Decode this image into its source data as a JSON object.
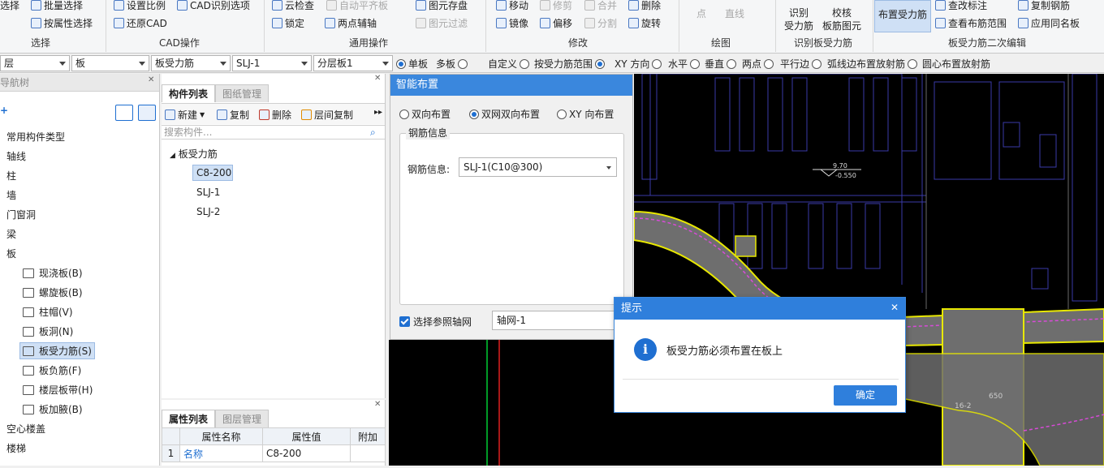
{
  "ribbon": {
    "items": [
      {
        "label": "选择",
        "icon": "select-icon"
      },
      {
        "label": "批量选择",
        "icon": "batch-select-icon"
      },
      {
        "label": "按属性选择",
        "icon": "select-by-property-icon"
      },
      {
        "label": "设置比例",
        "icon": "set-scale-icon"
      },
      {
        "label": "CAD识别选项",
        "icon": "cad-options-icon"
      },
      {
        "label": "还原CAD",
        "icon": "restore-cad-icon"
      },
      {
        "label": "云检查",
        "icon": "cloud-check-icon"
      },
      {
        "label": "自动平齐板",
        "icon": "auto-align-icon"
      },
      {
        "label": "图元存盘",
        "icon": "save-element-icon"
      },
      {
        "label": "锁定",
        "icon": "lock-icon"
      },
      {
        "label": "两点辅轴",
        "icon": "two-point-axis-icon"
      },
      {
        "label": "图元过滤",
        "icon": "filter-icon"
      },
      {
        "label": "移动",
        "icon": "move-icon"
      },
      {
        "label": "修剪",
        "icon": "trim-icon"
      },
      {
        "label": "合并",
        "icon": "merge-icon"
      },
      {
        "label": "删除",
        "icon": "delete-icon"
      },
      {
        "label": "镜像",
        "icon": "mirror-icon"
      },
      {
        "label": "偏移",
        "icon": "offset-icon"
      },
      {
        "label": "分割",
        "icon": "split-icon"
      },
      {
        "label": "旋转",
        "icon": "rotate-icon"
      },
      {
        "label": "点",
        "icon": "point-icon"
      },
      {
        "label": "直线",
        "icon": "line-icon"
      },
      {
        "label": "查改标注",
        "icon": "edit-annotation-icon"
      },
      {
        "label": "复制钢筋",
        "icon": "copy-rebar-icon"
      },
      {
        "label": "查看布筋范围",
        "icon": "view-range-icon"
      },
      {
        "label": "应用同名板",
        "icon": "apply-same-icon"
      }
    ],
    "big_buttons": {
      "identify_l1": "识别",
      "identify_l2": "受力筋",
      "verify_l1": "校核",
      "verify_l2": "板筋图元",
      "place": "布置受力筋"
    },
    "groups": [
      "选择",
      "CAD操作",
      "通用操作",
      "修改",
      "绘图",
      "识别板受力筋",
      "板受力筋二次编辑"
    ]
  },
  "toolbar": {
    "combos": [
      "层",
      "板",
      "板受力筋",
      "SLJ-1",
      "分层板1"
    ],
    "radios": [
      {
        "label": "单板",
        "on": true
      },
      {
        "label": "多板",
        "on": false
      },
      {
        "label": "自定义",
        "on": false
      },
      {
        "label": "按受力筋范围",
        "on": false
      },
      {
        "label": "XY 方向",
        "on": true
      },
      {
        "label": "水平",
        "on": false
      },
      {
        "label": "垂直",
        "on": false
      },
      {
        "label": "两点",
        "on": false
      },
      {
        "label": "平行边",
        "on": false
      },
      {
        "label": "弧线边布置放射筋",
        "on": false
      },
      {
        "label": "圆心布置放射筋",
        "on": false
      }
    ]
  },
  "nav": {
    "title": "导航树",
    "items": [
      {
        "label": "常用构件类型"
      },
      {
        "label": "轴线"
      },
      {
        "label": "柱"
      },
      {
        "label": "墙"
      },
      {
        "label": "门窗洞"
      },
      {
        "label": "梁"
      },
      {
        "label": "板"
      },
      {
        "label": "现浇板(B)",
        "icon": "cast-slab-icon"
      },
      {
        "label": "螺旋板(B)",
        "icon": "spiral-slab-icon"
      },
      {
        "label": "柱帽(V)",
        "icon": "column-cap-icon"
      },
      {
        "label": "板洞(N)",
        "icon": "slab-hole-icon"
      },
      {
        "label": "板受力筋(S)",
        "icon": "slab-rebar-icon",
        "selected": true
      },
      {
        "label": "板负筋(F)",
        "icon": "negative-rebar-icon"
      },
      {
        "label": "楼层板带(H)",
        "icon": "slab-strip-icon"
      },
      {
        "label": "板加腋(B)",
        "icon": "slab-haunch-icon"
      },
      {
        "label": "空心楼盖"
      },
      {
        "label": "楼梯"
      }
    ]
  },
  "components": {
    "tab_active": "构件列表",
    "tab_other": "图纸管理",
    "new_label": "新建",
    "copy_label": "复制",
    "delete_label": "删除",
    "layer_copy_label": "层间复制",
    "search_placeholder": "搜索构件...",
    "tree_root": "板受力筋",
    "tree_children": [
      "C8-200",
      "SLJ-1",
      "SLJ-2"
    ]
  },
  "properties": {
    "tab_active": "属性列表",
    "tab_other": "图层管理",
    "headers": [
      "属性名称",
      "属性值",
      "附加"
    ],
    "rows": [
      {
        "num": "1",
        "name": "名称",
        "value": "C8-200"
      }
    ]
  },
  "smart_panel": {
    "title": "智能布置",
    "radios": [
      {
        "label": "双向布置",
        "on": false
      },
      {
        "label": "双网双向布置",
        "on": true
      },
      {
        "label": "XY 向布置",
        "on": false
      }
    ],
    "group_label": "钢筋信息",
    "rebar_field_label": "钢筋信息:",
    "rebar_value": "SLJ-1(C10@300)",
    "axis_check_label": "选择参照轴网",
    "axis_value": "轴网-1"
  },
  "cad": {
    "elev_top": "9.70",
    "elev_bottom": "-0.550",
    "label_a": "16-2",
    "label_b": "650"
  },
  "dialog": {
    "title": "提示",
    "message": "板受力筋必须布置在板上",
    "ok_label": "确定"
  }
}
